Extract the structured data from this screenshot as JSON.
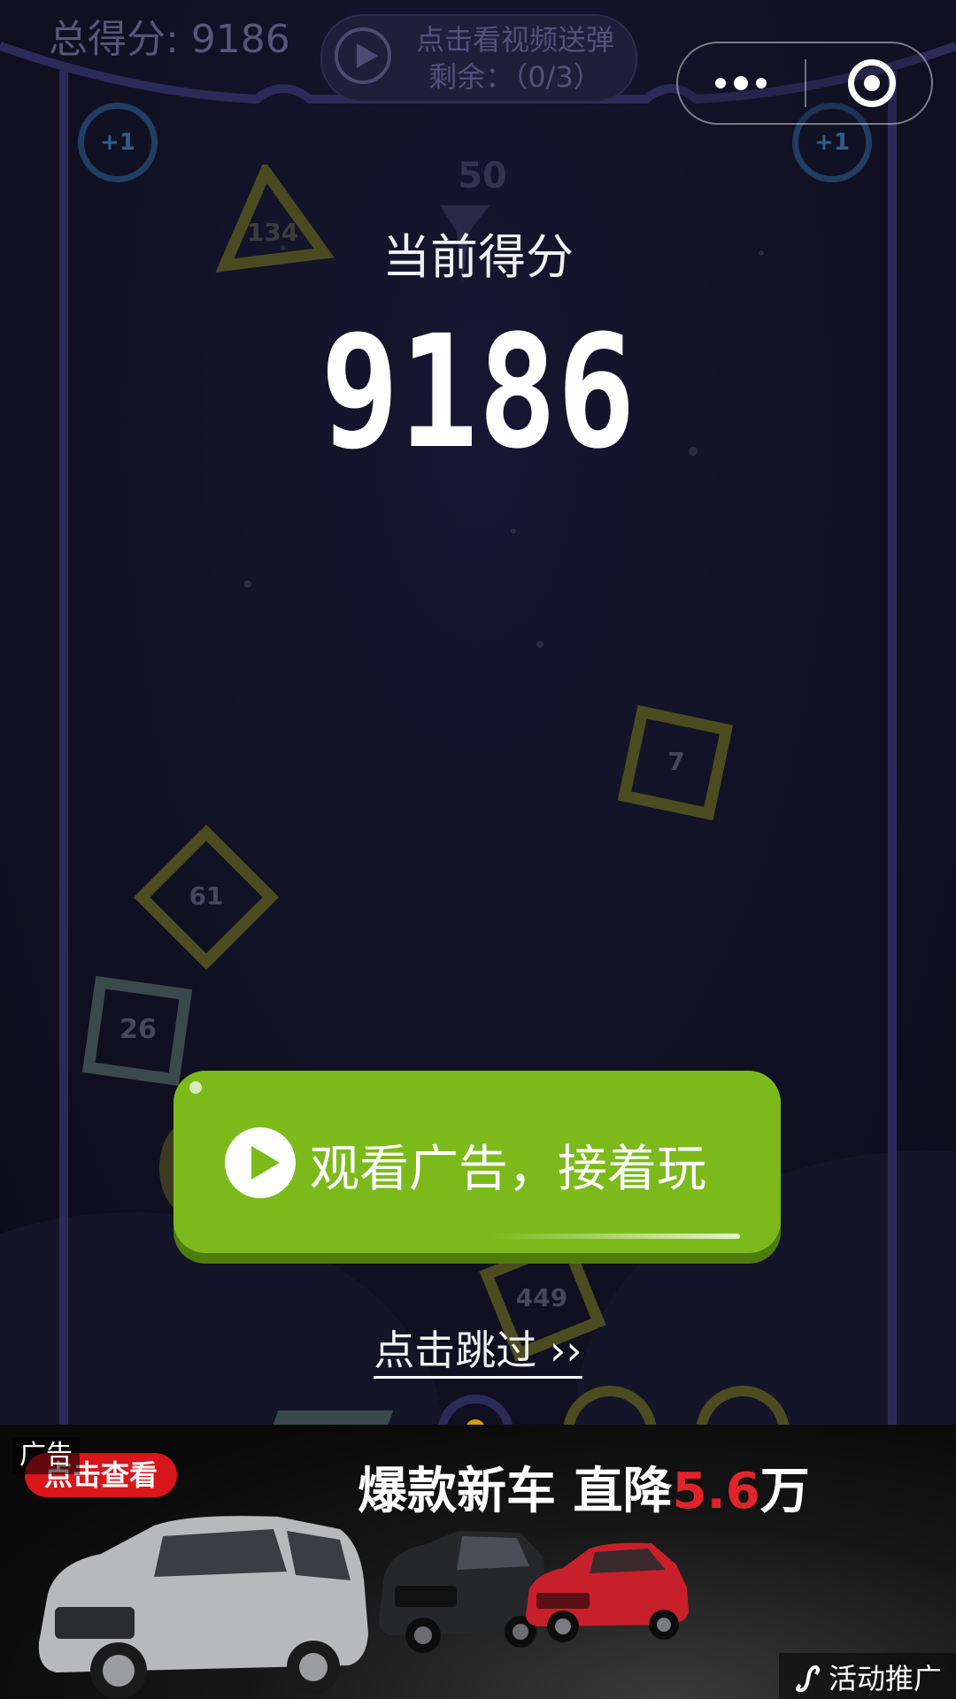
{
  "hud": {
    "total_score_label": "总得分: 9186",
    "video_ammo_line1": "点击看视频送弹",
    "video_ammo_line2": "剩余：（0/3）",
    "ball_count": "50",
    "plus_left": "+1",
    "plus_right": "+1"
  },
  "overlay": {
    "current_score_label": "当前得分",
    "current_score": "9186",
    "watch_ad_button": "观看广告，接着玩",
    "skip_link": "点击跳过"
  },
  "blocks": {
    "triangle": "134",
    "square_right": "7",
    "diamond_left": "61",
    "square_left": "26",
    "square_bottom": "449"
  },
  "banner_ad": {
    "ad_tag": "广告",
    "cta": "点击查看",
    "headline_white_1": "爆款新车 ",
    "headline_white_2": "直降",
    "headline_red": "5.6",
    "headline_white_3": "万",
    "promo_label": "活动推广"
  },
  "colors": {
    "background": "#111124",
    "button_green": "#7cba1c",
    "block_olive": "#4c4c20",
    "block_gray": "#3a4a4a",
    "frame_blue": "#2b2b5a",
    "headline_red": "#e2242a"
  },
  "icons": [
    "play-icon",
    "more-dots-icon",
    "target-close-icon",
    "link-icon"
  ]
}
